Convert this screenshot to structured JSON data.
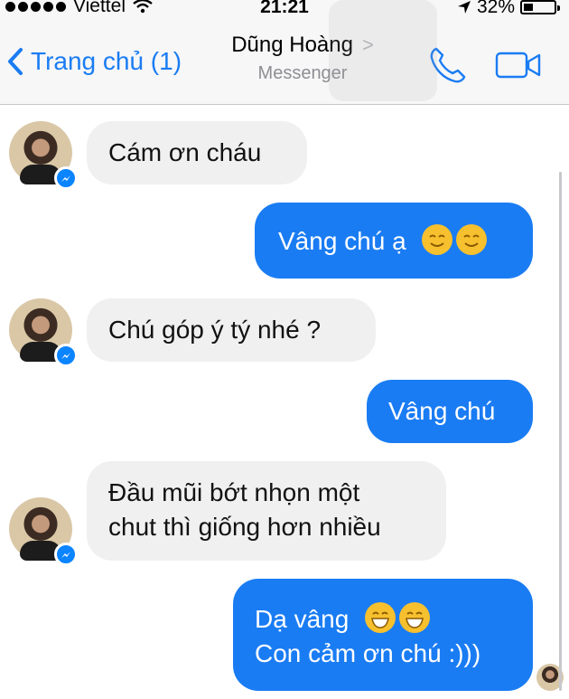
{
  "status_bar": {
    "carrier": "Viettel",
    "time": "21:21",
    "battery": "32%"
  },
  "header": {
    "back_label": "Trang chủ (1)",
    "title": "Dũng Hoàng",
    "subtitle": "Messenger"
  },
  "messages": [
    {
      "dir": "in",
      "text": "Cám ơn cháu"
    },
    {
      "dir": "out",
      "text": "Vâng chú ạ",
      "emoji": [
        "smile-blush-emoji",
        "smile-blush-emoji"
      ]
    },
    {
      "dir": "in",
      "text": "Chú góp ý tý nhé ?"
    },
    {
      "dir": "out",
      "text": "Vâng chú"
    },
    {
      "dir": "in",
      "lines": [
        "Đầu mũi bớt nhọn một",
        "chut thì giống hơn nhiều"
      ]
    },
    {
      "dir": "out",
      "lines": [
        "Dạ vâng",
        "Con cảm ơn chú :)))"
      ],
      "emoji": [
        "grin-emoji",
        "grin-emoji"
      ]
    }
  ],
  "colors": {
    "accent": "#1a7cf3",
    "incoming_bubble": "#f0f0f0",
    "messenger_badge": "#0b84ff"
  }
}
